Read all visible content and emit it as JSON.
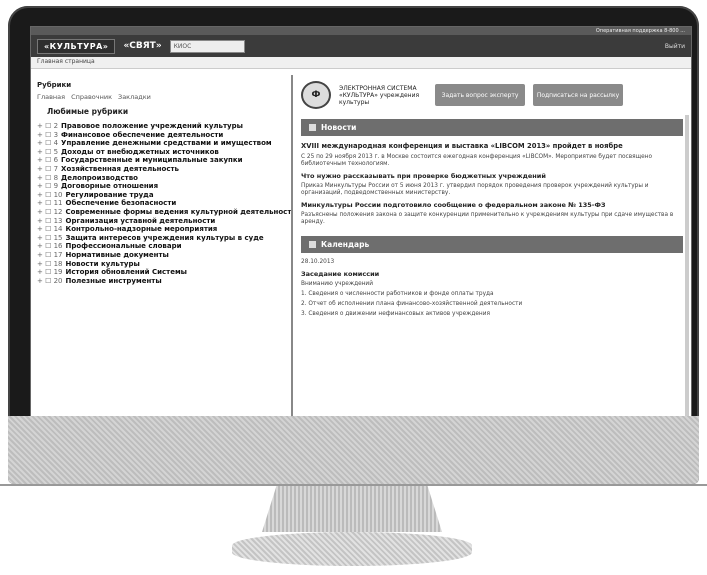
{
  "app": {
    "logo": "«КУЛЬТУРА»",
    "subtitle": "«СВЯТ»",
    "search_value": "КИОС",
    "header_right": "Выйти",
    "topbar_text": "Оперативная поддержка 8-800 ...",
    "breadcrumb": "Главная страница"
  },
  "left": {
    "heading": "Рубрики",
    "tabs": [
      "Главная",
      "Справочник",
      "Закладки"
    ],
    "favorites": "Любимые рубрики",
    "tree": [
      {
        "pre": "+ ☐ 2",
        "label": "Правовое положение учреждений культуры"
      },
      {
        "pre": "+ ☐ 3",
        "label": "Финансовое обеспечение деятельности"
      },
      {
        "pre": "+ ☐ 4",
        "label": "Управление денежными средствами и имуществом"
      },
      {
        "pre": "+ ☐ 5",
        "label": "Доходы от внебюджетных источников"
      },
      {
        "pre": "+ ☐ 6",
        "label": "Государственные и муниципальные закупки"
      },
      {
        "pre": "+ ☐ 7",
        "label": "Хозяйственная деятельность"
      },
      {
        "pre": "+ ☐ 8",
        "label": "Делопроизводство"
      },
      {
        "pre": "+ ☐ 9",
        "label": "Договорные отношения"
      },
      {
        "pre": "+ ☐ 10",
        "label": "Регулирование труда"
      },
      {
        "pre": "+ ☐ 11",
        "label": "Обеспечение безопасности"
      },
      {
        "pre": "+ ☐ 12",
        "label": "Современные формы ведения культурной деятельности"
      },
      {
        "pre": "+ ☐ 13",
        "label": "Организация уставной деятельности"
      },
      {
        "pre": "+ ☐ 14",
        "label": "Контрольно-надзорные мероприятия"
      },
      {
        "pre": "+ ☐ 15",
        "label": "Защита интересов учреждения культуры в суде"
      },
      {
        "pre": "+ ☐ 16",
        "label": "Профессиональные словари"
      },
      {
        "pre": "+ ☐ 17",
        "label": "Нормативные документы"
      },
      {
        "pre": "+ ☐ 18",
        "label": "Новости культуры"
      },
      {
        "pre": "+ ☐ 19",
        "label": "История обновлений Системы"
      },
      {
        "pre": "+ ☐ 20",
        "label": "Полезные инструменты"
      }
    ]
  },
  "right": {
    "emblem": "Ф",
    "org_text": "ЭЛЕКТРОННАЯ СИСТЕМА «КУЛЬТУРА» учреждения культуры",
    "btn1": "Задать вопрос эксперту",
    "btn2": "Подписаться на рассылку",
    "news_section": "Новости",
    "news_title": "XVIII международная конференция и выставка «LIBCOM 2013» пройдет в ноябре",
    "news_text1": "С 25 по 29 ноября 2013 г. в Москве состоится ежегодная конференция «LIBCOM». Мероприятие будет посвящено библиотечным технологиям.",
    "news_head2": "Что нужно рассказывать при проверке бюджетных учреждений",
    "news_text2": "Приказ Минкультуры России от 5 июня 2013 г. утвердил порядок проведения проверок учреждений культуры и организаций, подведомственных министерству.",
    "news_head3": "Минкультуры России подготовило сообщение о федеральном законе № 135-ФЗ",
    "news_text3": "Разъяснены положения закона о защите конкуренции применительно к учреждениям культуры при сдаче имущества в аренду.",
    "calendar_section": "Календарь",
    "date": "28.10.2013",
    "cal_title": "Заседание комиссии",
    "cal_sub": "Вниманию учреждений",
    "list": [
      "1. Сведения о численности работников и фонде оплаты труда",
      "2. Отчет об исполнении плана финансово-хозяйственной деятельности",
      "3. Сведения о движении нефинансовых активов учреждения"
    ]
  }
}
